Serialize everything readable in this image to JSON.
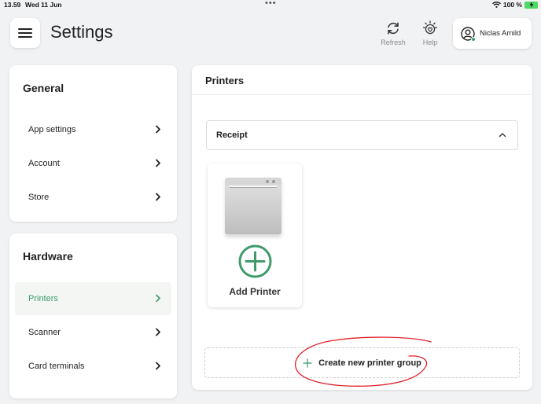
{
  "status_bar": {
    "time": "13.59",
    "date": "Wed 11 Jun",
    "battery": "100 %"
  },
  "header": {
    "title": "Settings",
    "refresh_label": "Refresh",
    "help_label": "Help",
    "user_name": "Niclas Arnild"
  },
  "general": {
    "title": "General",
    "items": [
      {
        "label": "App settings"
      },
      {
        "label": "Account"
      },
      {
        "label": "Store"
      }
    ]
  },
  "hardware": {
    "title": "Hardware",
    "items": [
      {
        "label": "Printers",
        "active": true
      },
      {
        "label": "Scanner"
      },
      {
        "label": "Card terminals"
      }
    ]
  },
  "printers_panel": {
    "title": "Printers",
    "group_name": "Receipt",
    "add_printer_label": "Add Printer",
    "create_group_label": "Create new printer group"
  },
  "colors": {
    "accent": "#3f9b6b",
    "annotation": "#e0202a"
  }
}
